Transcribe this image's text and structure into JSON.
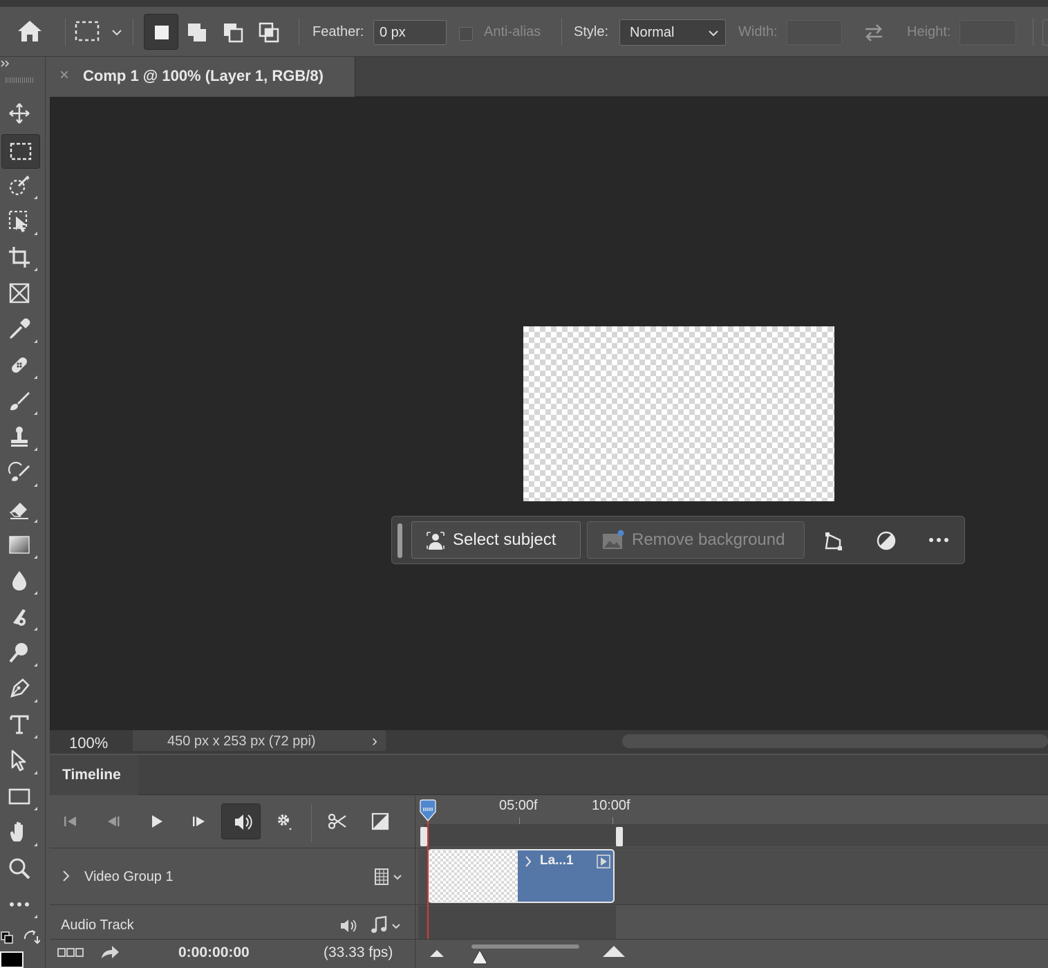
{
  "options_bar": {
    "feather_label": "Feather:",
    "feather_value": "0 px",
    "anti_alias_label": "Anti-alias",
    "style_label": "Style:",
    "style_value": "Normal",
    "width_label": "Width:",
    "width_value": "",
    "height_label": "Height:",
    "height_value": ""
  },
  "tab": {
    "title": "Comp 1 @ 100% (Layer 1, RGB/8)",
    "close_glyph": "×"
  },
  "contextual_taskbar": {
    "select_subject_label": "Select subject",
    "remove_background_label": "Remove background"
  },
  "status": {
    "zoom": "100%",
    "doc_info": "450 px x 253 px (72 ppi)",
    "arrow": "›"
  },
  "timeline": {
    "panel_title": "Timeline",
    "ruler_labels": [
      "05:00f",
      "10:00f"
    ],
    "tracks": {
      "video_group": "Video Group 1",
      "audio_track": "Audio Track"
    },
    "clip_label": "La...1",
    "current_time": "0:00:00:00",
    "fps": "(33.33 fps)"
  },
  "colors": {
    "clip_blue": "#5577a8",
    "playhead_red": "#d23b3b",
    "playhead_marker_blue": "#4f88cf"
  }
}
